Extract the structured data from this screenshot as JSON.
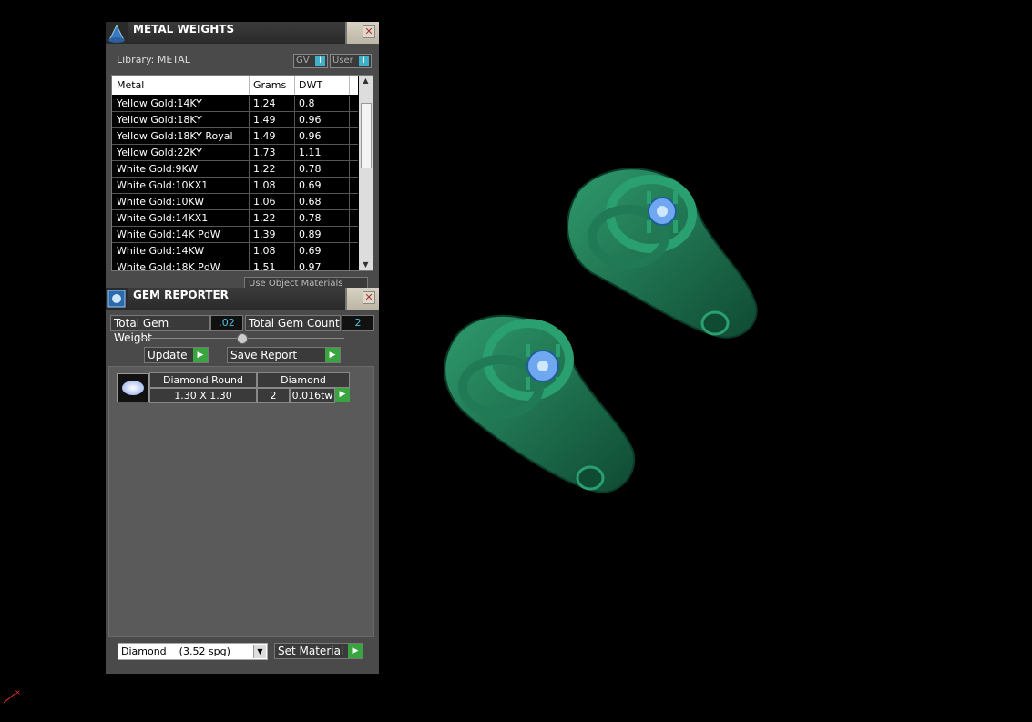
{
  "metal_weights": {
    "title": "METAL WEIGHTS",
    "library_label": "Library: METAL",
    "toggle_gv": "GV",
    "toggle_user": "User",
    "toggle_knob": "I",
    "columns": [
      "Metal",
      "Grams",
      "DWT"
    ],
    "rows": [
      {
        "metal": "Yellow Gold:14KY",
        "grams": "1.24",
        "dwt": "0.8"
      },
      {
        "metal": "Yellow Gold:18KY",
        "grams": "1.49",
        "dwt": "0.96"
      },
      {
        "metal": "Yellow Gold:18KY Royal",
        "grams": "1.49",
        "dwt": "0.96"
      },
      {
        "metal": "Yellow Gold:22KY",
        "grams": "1.73",
        "dwt": "1.11"
      },
      {
        "metal": "White Gold:9KW",
        "grams": "1.22",
        "dwt": "0.78"
      },
      {
        "metal": "White Gold:10KX1",
        "grams": "1.08",
        "dwt": "0.69"
      },
      {
        "metal": "White Gold:10KW",
        "grams": "1.06",
        "dwt": "0.68"
      },
      {
        "metal": "White Gold:14KX1",
        "grams": "1.22",
        "dwt": "0.78"
      },
      {
        "metal": "White Gold:14K PdW",
        "grams": "1.39",
        "dwt": "0.89"
      },
      {
        "metal": "White Gold:14KW",
        "grams": "1.08",
        "dwt": "0.69"
      },
      {
        "metal": "White Gold:18K PdW",
        "grams": "1.51",
        "dwt": "0.97"
      }
    ],
    "use_object_materials": "Use Object Materials"
  },
  "gem_reporter": {
    "title": "GEM REPORTER",
    "total_gem_weight_label": "Total Gem Weight",
    "total_gem_weight_value": ".02",
    "total_gem_count_label": "Total Gem Count",
    "total_gem_count_value": "2",
    "update_label": "Update",
    "save_report_label": "Save Report",
    "gem": {
      "shape": "Diamond Round",
      "material": "Diamond",
      "size": "1.30 X 1.30",
      "count": "2",
      "weight": "0.016tw"
    },
    "material_select": "Diamond    (3.52 spg)",
    "set_material_label": "Set Material"
  },
  "colors": {
    "ring_green": "#1f7a55",
    "gem_blue": "#6fa8f0",
    "go_green": "#3aa540",
    "value_cyan": "#4fc3e0"
  }
}
